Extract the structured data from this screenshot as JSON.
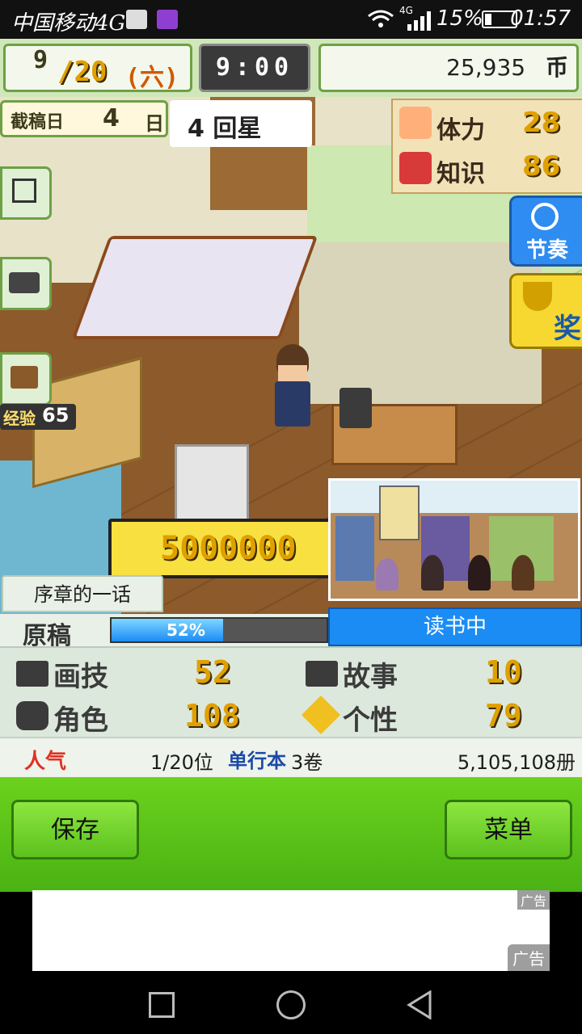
{
  "status_bar": {
    "carrier": "中国移动4G",
    "signal_label": "4G",
    "battery": "15%",
    "time": "01:57"
  },
  "hud": {
    "month": "9",
    "week": "/20",
    "weekday": "(六)",
    "clock": "9:00",
    "money": "25,935",
    "currency": "币"
  },
  "scene": {
    "deadline_label": "截稿日",
    "deadline_value": "4",
    "deadline_unit": "日",
    "serial_label": "4 回星",
    "stamina_label": "体力",
    "stamina_value": "28",
    "knowledge_label": "知识",
    "knowledge_value": "86",
    "rhythm_label": "节奏",
    "award_label": "奖",
    "exp_label": "经验",
    "exp_value": "65",
    "bonus_value": "5000000"
  },
  "novel": {
    "chapter": "序章的一话",
    "manuscript_label": "原稿",
    "progress_text": "52%",
    "progress": 0.52,
    "reading": "读书中",
    "stats": [
      {
        "label": "画技",
        "value": "52"
      },
      {
        "label": "故事",
        "value": "10"
      },
      {
        "label": "角色",
        "value": "108"
      },
      {
        "label": "个性",
        "value": "79"
      }
    ],
    "popularity_label": "人气",
    "rank": "1/20位",
    "volume_label": "单行本",
    "volumes": "3卷",
    "copies": "5,105,108册"
  },
  "buttons": {
    "save": "保存",
    "menu": "菜单"
  },
  "ad": {
    "tag_top": "广告",
    "tag_bottom": "广告"
  },
  "colors": {
    "hud_border": "#6ea046",
    "reading_blue": "#1c8cf5",
    "bottom_green": "#5cc11d",
    "gold": "#e0b000"
  }
}
